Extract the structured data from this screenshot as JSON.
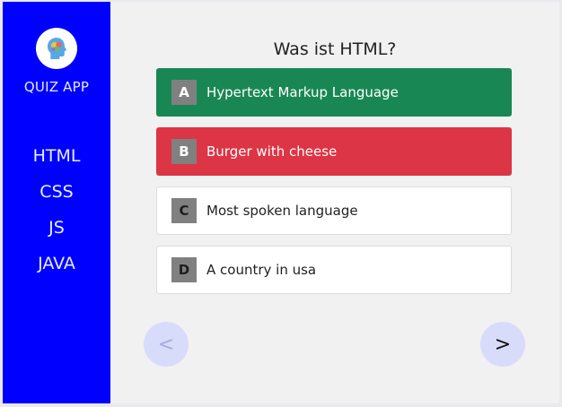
{
  "sidebar": {
    "app_title": "QUIZ APP",
    "logo_icon": "brain-head-icon",
    "items": [
      {
        "label": "HTML"
      },
      {
        "label": "CSS"
      },
      {
        "label": "JS"
      },
      {
        "label": "JAVA"
      }
    ],
    "color": "#0000ff"
  },
  "quiz": {
    "question": "Was ist HTML?",
    "options": [
      {
        "letter": "A",
        "text": "Hypertext Markup Language",
        "state": "correct"
      },
      {
        "letter": "B",
        "text": "Burger with cheese",
        "state": "wrong"
      },
      {
        "letter": "C",
        "text": "Most spoken language",
        "state": "neutral"
      },
      {
        "letter": "D",
        "text": "A country in usa",
        "state": "neutral"
      }
    ],
    "prev_label": "<",
    "next_label": ">"
  },
  "colors": {
    "correct": "#198754",
    "wrong": "#dc3545",
    "nav_button": "#d7dcfb"
  }
}
